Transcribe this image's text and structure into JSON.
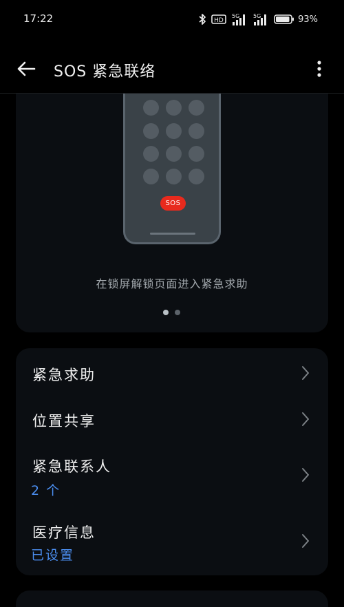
{
  "status_bar": {
    "time": "17:22",
    "icons": [
      "bluetooth-icon",
      "hd-voice-icon",
      "signal-5g-icon",
      "signal-5g-icon",
      "battery-icon"
    ],
    "hd_label": "HD",
    "network_1": "5G",
    "network_2": "5G",
    "battery_text": "93%",
    "battery_level": 0.93
  },
  "app_bar": {
    "title": "SOS 紧急联络"
  },
  "banner": {
    "sos_label": "SOS",
    "caption": "在锁屏解锁页面进入紧急求助",
    "page_count": 2,
    "active_page": 0
  },
  "settings": {
    "items": [
      {
        "title": "紧急求助",
        "subtitle": ""
      },
      {
        "title": "位置共享",
        "subtitle": ""
      },
      {
        "title": "紧急联系人",
        "subtitle": "2 个"
      },
      {
        "title": "医疗信息",
        "subtitle": "已设置"
      }
    ]
  },
  "colors": {
    "background": "#000000",
    "card": "#0b0e12",
    "accent": "#4b8ef0",
    "sos_red": "#e82a1d"
  }
}
